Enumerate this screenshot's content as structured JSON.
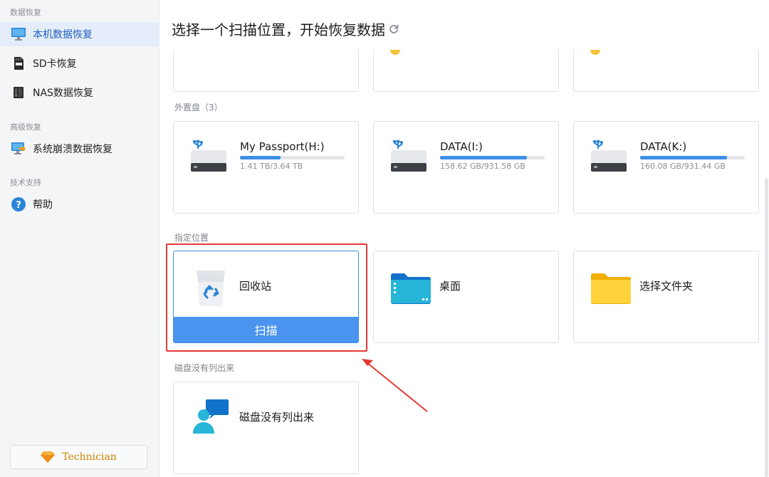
{
  "sidebar": {
    "sections": [
      {
        "label": "数据恢复"
      },
      {
        "label": "高级恢复"
      },
      {
        "label": "技术支持"
      }
    ],
    "items": [
      {
        "label": "本机数据恢复",
        "icon": "monitor-icon",
        "active": true
      },
      {
        "label": "SD卡恢复",
        "icon": "sd-card-icon"
      },
      {
        "label": "NAS数据恢复",
        "icon": "nas-icon"
      },
      {
        "label": "系统崩溃数据恢复",
        "icon": "system-crash-icon"
      },
      {
        "label": "帮助",
        "icon": "help-icon"
      }
    ],
    "technician_label": "Technician"
  },
  "header": {
    "title": "选择一个扫描位置，开始恢复数据",
    "refresh_icon": "refresh-icon"
  },
  "groups": {
    "external": {
      "label": "外置盘（3）"
    },
    "specified": {
      "label": "指定位置"
    },
    "not_listed": {
      "label": "磁盘没有列出来"
    }
  },
  "drives": [
    {
      "name": "My Passport(H:)",
      "size": "1.41 TB/3.64 TB",
      "used_fraction": 0.387
    },
    {
      "name": "DATA(I:)",
      "size": "158.62 GB/931.58 GB",
      "used_fraction": 0.83
    },
    {
      "name": "DATA(K:)",
      "size": "160.08 GB/931.44 GB",
      "used_fraction": 0.83
    }
  ],
  "locations": [
    {
      "name": "回收站",
      "icon": "recycle-bin-icon",
      "selected": true
    },
    {
      "name": "桌面",
      "icon": "desktop-folder-icon"
    },
    {
      "name": "选择文件夹",
      "icon": "folder-icon"
    }
  ],
  "scan_label": "扫描",
  "not_listed_card": {
    "name": "磁盘没有列出来",
    "icon": "support-chat-icon"
  },
  "colors": {
    "accent": "#4a94f0",
    "sidebar_active_bg": "#e4edf9",
    "highlight": "#e53935",
    "technician": "#c98300"
  }
}
